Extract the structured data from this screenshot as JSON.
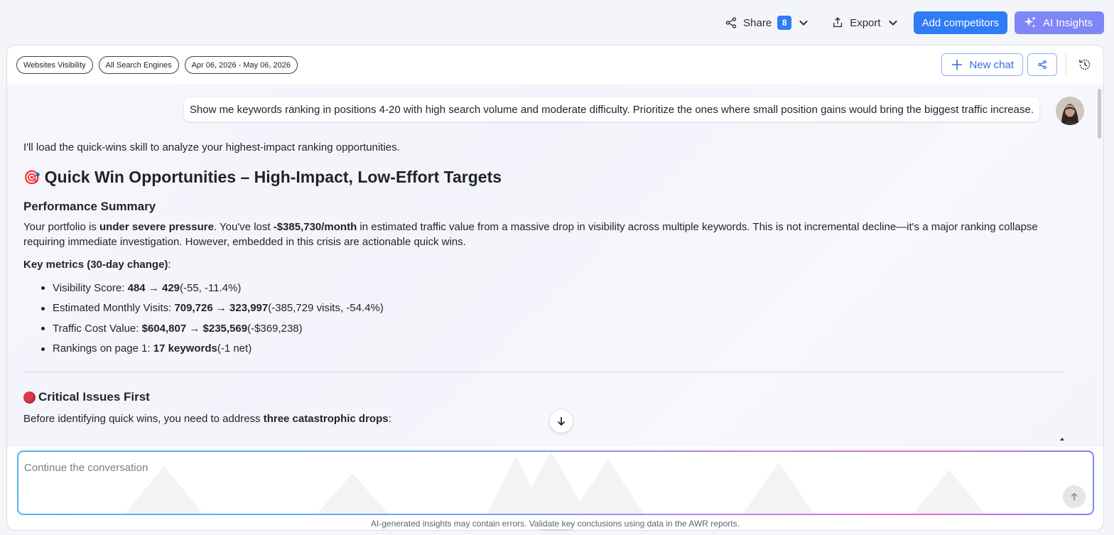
{
  "topbar": {
    "share_label": "Share",
    "share_count": "8",
    "export_label": "Export",
    "add_competitors_label": "Add competitors",
    "ai_insights_label": "AI Insights"
  },
  "filters": {
    "project": "Websites Visibility",
    "engines": "All Search Engines",
    "date_range": "Apr 06, 2026 - May 06, 2026"
  },
  "header": {
    "new_chat_label": "New chat"
  },
  "chat": {
    "user_message": "Show me keywords ranking in positions 4-20 with high search volume and moderate difficulty. Prioritize the ones where small position gains would bring the biggest traffic increase.",
    "intro": "I'll load the quick-wins skill to analyze your highest-impact ranking opportunities.",
    "title_emoji": "🎯",
    "title": "Quick Win Opportunities – High-Impact, Low-Effort Targets",
    "summary_heading": "Performance Summary",
    "summary": {
      "p1": "Your portfolio is ",
      "b1": "under severe pressure",
      "p2": ". You've lost ",
      "b2": "-$385,730/month",
      "p3": " in estimated traffic value from a massive drop in visibility across multiple keywords. This is not incremental decline—it's a major ranking collapse requiring immediate investigation. However, embedded in this crisis are actionable quick wins."
    },
    "metrics_heading": "Key metrics (30-day change)",
    "metrics_colon": ":",
    "metrics": [
      {
        "label": "Visibility Score: ",
        "value": "484 → 429",
        "delta": " (-55, -11.4%)"
      },
      {
        "label": "Estimated Monthly Visits: ",
        "value": "709,726 → 323,997",
        "delta": " (-385,729 visits, -54.4%)"
      },
      {
        "label": "Traffic Cost Value: ",
        "value": "$604,807 → $235,569",
        "delta": " (-$369,238)"
      },
      {
        "label": "Rankings on page 1: ",
        "value": "17 keywords",
        "delta": " (-1 net)"
      }
    ],
    "critical_heading": "Critical Issues First",
    "critical_text": {
      "p1": "Before identifying quick wins, you need to address ",
      "b1": "three catastrophic drops",
      "p2": ":"
    }
  },
  "input": {
    "placeholder": "Continue the conversation"
  },
  "disclaimer": "AI-generated insights may contain errors. Validate key conclusions using data in the AWR reports.",
  "colors": {
    "primary": "#2f7cf6",
    "ai_button": "#7f86f7",
    "critical_dot": "#d9394a"
  }
}
